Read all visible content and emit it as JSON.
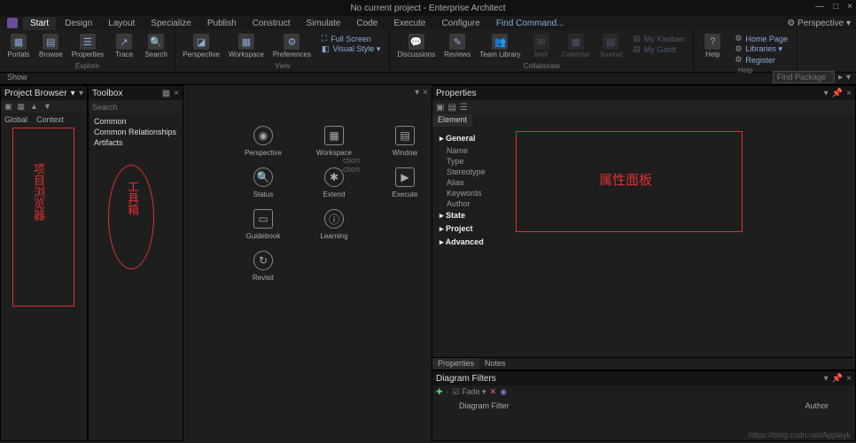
{
  "window": {
    "title": "No current project - Enterprise Architect",
    "perspective": "Perspective"
  },
  "tabs": [
    "Start",
    "Design",
    "Layout",
    "Specialize",
    "Publish",
    "Construct",
    "Simulate",
    "Code",
    "Execute",
    "Configure"
  ],
  "find_command": "Find Command...",
  "ribbon": {
    "explore": {
      "caption": "Explore",
      "buttons": [
        {
          "label": "Portals"
        },
        {
          "label": "Browse"
        },
        {
          "label": "Properties"
        },
        {
          "label": "Trace"
        },
        {
          "label": "Search"
        }
      ]
    },
    "view": {
      "caption": "View",
      "buttons": [
        {
          "label": "Perspective"
        },
        {
          "label": "Workspace"
        },
        {
          "label": "Preferences"
        }
      ],
      "opts": [
        "Full Screen",
        "Visual Style ▾"
      ]
    },
    "collab": {
      "caption": "Collaborate",
      "buttons": [
        {
          "label": "Discussions"
        },
        {
          "label": "Reviews"
        },
        {
          "label": "Team Library"
        },
        {
          "label": "Mail"
        },
        {
          "label": "Calendar"
        },
        {
          "label": "Journal"
        }
      ],
      "opts": [
        "My Kanban",
        "My Gantt"
      ]
    },
    "help": {
      "caption": "Help",
      "button": "Help",
      "links": [
        "Home Page",
        "Libraries ▾",
        "Register"
      ]
    }
  },
  "show_label": "Show",
  "find_package": {
    "placeholder": "Find Package"
  },
  "browser": {
    "title": "Project Browser",
    "tabs": [
      "Global",
      "Context"
    ]
  },
  "toolbox": {
    "title": "Toolbox",
    "search_placeholder": "Search",
    "items": [
      "Common",
      "Common Relationships",
      "Artifacts"
    ]
  },
  "portal_items": [
    {
      "label": "Perspective",
      "icon": "◉"
    },
    {
      "label": "Workspace",
      "icon": "▦"
    },
    {
      "label": "Window",
      "icon": "▤"
    },
    {
      "label": "Status",
      "icon": "🔍"
    },
    {
      "label": "Extend",
      "icon": "✱"
    },
    {
      "label": "Execute",
      "icon": "▶"
    },
    {
      "label": "Guidebook",
      "icon": "▭"
    },
    {
      "label": "Learning",
      "icon": "ⓘ"
    },
    {
      "label": "Revisit",
      "icon": "↻"
    }
  ],
  "hints": [
    "ction",
    "ction"
  ],
  "properties": {
    "title": "Properties",
    "tab": "Element",
    "groups": [
      {
        "name": "General",
        "fields": [
          "Name",
          "Type",
          "Stereotype",
          "Alias",
          "Keywords",
          "Author"
        ]
      },
      {
        "name": "State",
        "fields": []
      },
      {
        "name": "Project",
        "fields": []
      },
      {
        "name": "Advanced",
        "fields": []
      }
    ],
    "bottom_tabs": [
      "Properties",
      "Notes"
    ]
  },
  "filters": {
    "title": "Diagram Filters",
    "fade": "Fade",
    "cols": [
      "Diagram Filter",
      "Author"
    ]
  },
  "annotations": {
    "a1": "项目浏览器",
    "a2": "工具箱",
    "a3": "属性面板"
  },
  "watermark": "https://blog.csdn.net/Appleyk"
}
